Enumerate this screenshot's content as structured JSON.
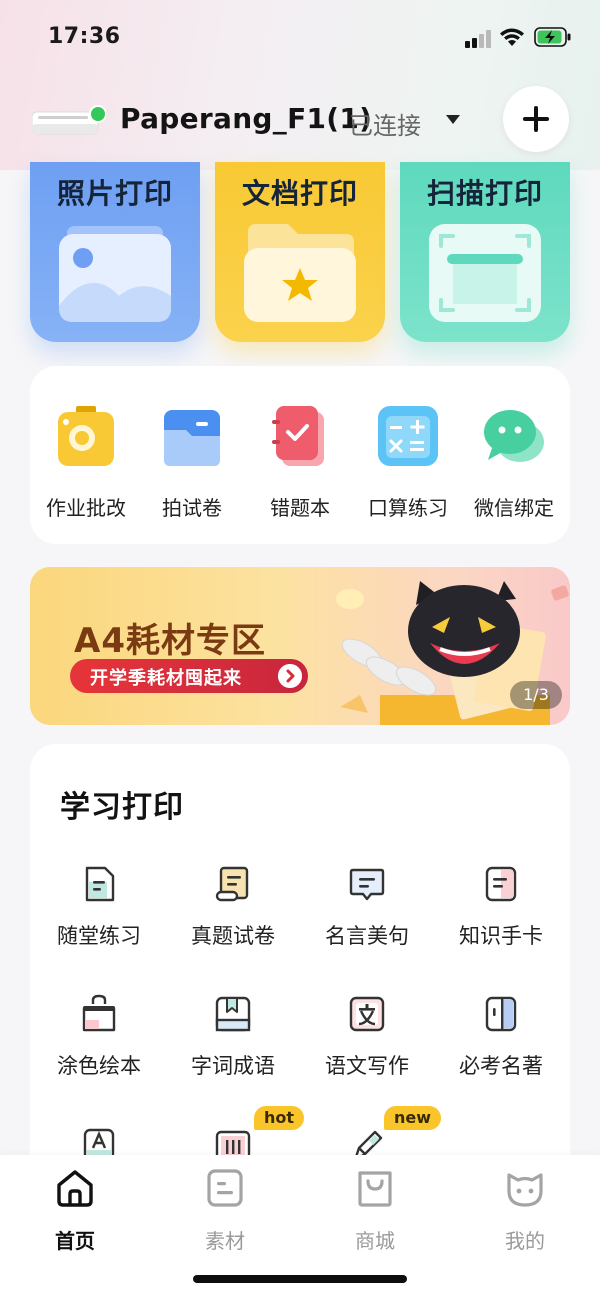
{
  "status_bar": {
    "time": "17:36"
  },
  "device": {
    "name": "Paperang_F1(1)",
    "status": "已连接",
    "connected_color": "#34c759"
  },
  "big_cards": [
    {
      "label": "照片打印",
      "color": "#6e9ff2",
      "icon": "photo-icon"
    },
    {
      "label": "文档打印",
      "color": "#f8c934",
      "icon": "folder-star-icon"
    },
    {
      "label": "扫描打印",
      "color": "#5ed9bd",
      "icon": "scan-icon"
    }
  ],
  "tools": [
    {
      "label": "作业批改",
      "icon": "homework-icon"
    },
    {
      "label": "拍试卷",
      "icon": "exam-folder-icon"
    },
    {
      "label": "错题本",
      "icon": "mistake-book-icon"
    },
    {
      "label": "口算练习",
      "icon": "calculator-icon"
    },
    {
      "label": "微信绑定",
      "icon": "wechat-icon"
    }
  ],
  "banner": {
    "title": "A4耗材专区",
    "subtitle": "开学季耗材囤起来",
    "page_indicator": "1/3"
  },
  "study": {
    "title": "学习打印",
    "items": [
      {
        "label": "随堂练习",
        "icon": "practice-icon"
      },
      {
        "label": "真题试卷",
        "icon": "scroll-icon"
      },
      {
        "label": "名言美句",
        "icon": "quote-bubble-icon"
      },
      {
        "label": "知识手卡",
        "icon": "card-icon"
      },
      {
        "label": "涂色绘本",
        "icon": "paint-bucket-icon"
      },
      {
        "label": "字词成语",
        "icon": "book-icon"
      },
      {
        "label": "语文写作",
        "icon": "wen-icon"
      },
      {
        "label": "必考名著",
        "icon": "classic-book-icon"
      }
    ],
    "badges": {
      "hot": "hot",
      "new": "new"
    }
  },
  "tab_bar": [
    {
      "label": "首页",
      "icon": "home-icon",
      "active": true
    },
    {
      "label": "素材",
      "icon": "material-icon",
      "active": false
    },
    {
      "label": "商城",
      "icon": "shop-bag-icon",
      "active": false
    },
    {
      "label": "我的",
      "icon": "cat-face-icon",
      "active": false
    }
  ]
}
